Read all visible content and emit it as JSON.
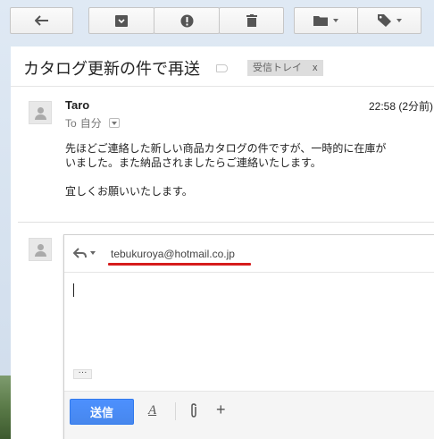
{
  "toolbar": {
    "back_icon": "back-arrow-icon",
    "archive_icon": "archive-icon",
    "spam_icon": "report-spam-icon",
    "delete_icon": "trash-icon",
    "move_icon": "folder-icon",
    "labels_icon": "label-tag-icon"
  },
  "message": {
    "subject": "カタログ更新の件で再送",
    "label_chip": "受信トレイ",
    "label_chip_close": "x",
    "sender": "Taro",
    "time": "22:58 (2分前)",
    "to_prefix": "To",
    "to_name": "自分",
    "body_lines": [
      "先ほどご連絡した新しい商品カタログの件ですが、一時的に在庫が",
      "いました。また納品されましたらご連絡いたします。",
      "宜しくお願いいたします。"
    ]
  },
  "reply": {
    "recipient": "tebukuroya@hotmail.co.jp",
    "ellipsis": "···",
    "send_label": "送信",
    "format_label": "A",
    "attach_icon": "paperclip-icon",
    "more_label": "+"
  },
  "colors": {
    "send_button": "#4d90fe",
    "underline_annotation": "#d61c1c"
  }
}
